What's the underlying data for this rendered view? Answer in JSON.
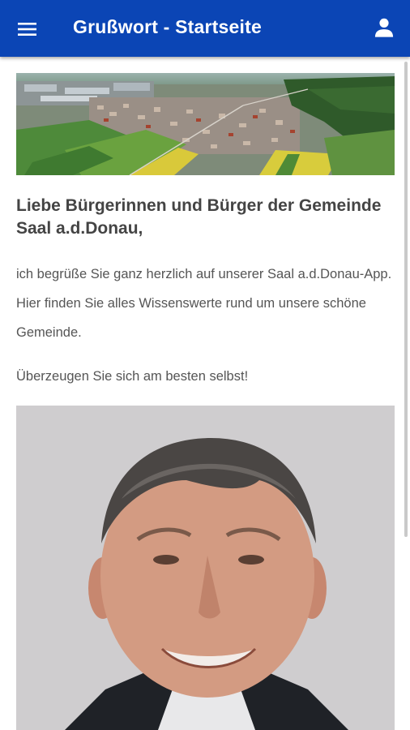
{
  "header": {
    "title": "Grußwort - Startseite",
    "menu_icon": "hamburger-menu-icon",
    "account_icon": "person-icon",
    "background_color": "#0b45b5"
  },
  "main": {
    "banner_image": "aerial-village-photo",
    "heading": "Liebe Bürgerinnen und Bürger der Gemeinde Saal a.d.Donau,",
    "paragraphs": [
      "ich begrüße Sie ganz herzlich auf unserer Saal a.d.Donau-App. Hier finden Sie alles Wissenswerte rund um unsere schöne Gemeinde.",
      "Überzeugen Sie sich am besten selbst!"
    ],
    "portrait_image": "mayor-portrait-photo"
  },
  "colors": {
    "text": "#555555",
    "heading": "#444444"
  }
}
